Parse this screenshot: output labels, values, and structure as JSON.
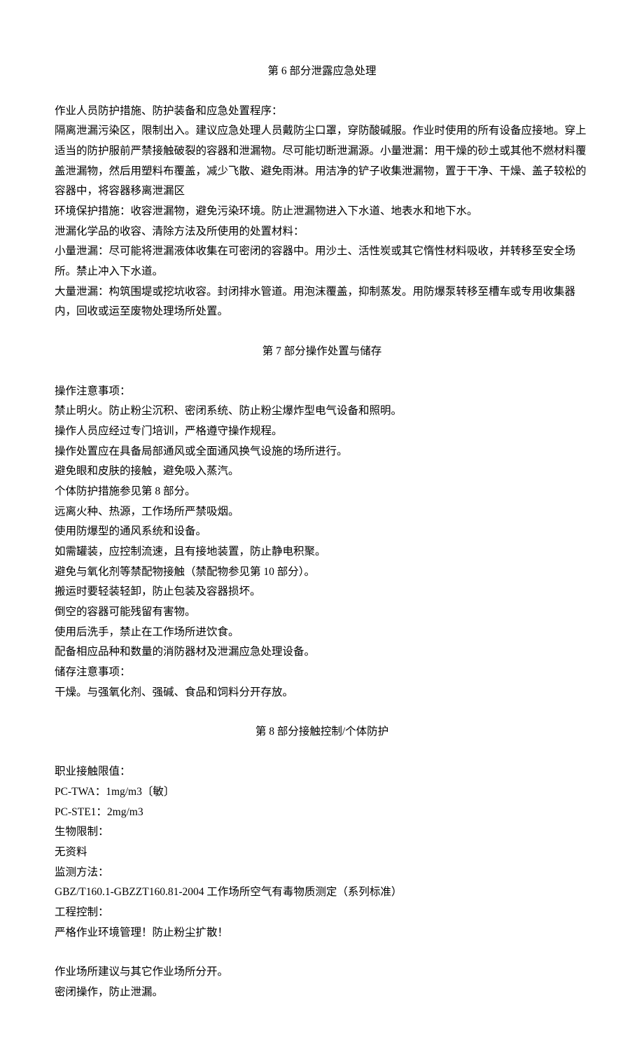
{
  "section6": {
    "title": "第 6 部分泄露应急处理",
    "p1": "作业人员防护措施、防护装备和应急处置程序：",
    "p2": "隔离泄漏污染区，限制出入。建议应急处理人员戴防尘口罩，穿防酸碱服。作业时使用的所有设备应接地。穿上适当的防护服前严禁接触破裂的容器和泄漏物。尽可能切断泄漏源。小量泄漏：用干燥的砂土或其他不燃材料覆盖泄漏物，然后用塑料布覆盖，减少飞散、避免雨淋。用洁净的铲子收集泄漏物，置于干净、干燥、盖子较松的容器中，将容器移离泄漏区",
    "p3": "环境保护措施：收容泄漏物，避免污染环境。防止泄漏物进入下水道、地表水和地下水。",
    "p4": "泄漏化学品的收容、清除方法及所使用的处置材料：",
    "p5": "小量泄漏：尽可能将泄漏液体收集在可密闭的容器中。用沙土、活性炭或其它惰性材料吸收，并转移至安全场所。禁止冲入下水道。",
    "p6": "大量泄漏：构筑围堤或挖坑收容。封闭排水管道。用泡沫覆盖，抑制蒸发。用防爆泵转移至槽车或专用收集器内，回收或运至废物处理场所处置。"
  },
  "section7": {
    "title": "第 7 部分操作处置与储存",
    "p1": "操作注意事项：",
    "p2": "禁止明火。防止粉尘沉积、密闭系统、防止粉尘爆炸型电气设备和照明。",
    "p3": "操作人员应经过专门培训，严格遵守操作规程。",
    "p4": "操作处置应在具备局部通风或全面通风换气设施的场所进行。",
    "p5": "避免眼和皮肤的接触，避免吸入蒸汽。",
    "p6": "个体防护措施参见第 8 部分。",
    "p7": "远离火种、热源，工作场所严禁吸烟。",
    "p8": "使用防爆型的通风系统和设备。",
    "p9": "如需罐装，应控制流速，且有接地装置，防止静电积聚。",
    "p10": "避免与氧化剂等禁配物接触（禁配物参见第 10 部分）。",
    "p11": "搬运时要轻装轻卸，防止包装及容器损坏。",
    "p12": "倒空的容器可能残留有害物。",
    "p13": "使用后洗手，禁止在工作场所进饮食。",
    "p14": "配备相应品种和数量的消防器材及泄漏应急处理设备。",
    "p15": "储存注意事项：",
    "p16": "干燥。与强氧化剂、强碱、食品和饲料分开存放。"
  },
  "section8": {
    "title": "第 8 部分接触控制/个体防护",
    "p1": "职业接触限值：",
    "p2": "PC-TWA：1mg/m3〔敏〕",
    "p3": "PC-STE1：2mg/m3",
    "p4": "生物限制：",
    "p5": "无资料",
    "p6": "监测方法：",
    "p7": "GBZ/T160.1-GBZZT160.81-2004 工作场所空气有毒物质测定（系列标准）",
    "p8": "工程控制：",
    "p9": "严格作业环境管理！防止粉尘扩散！",
    "p10": "作业场所建议与其它作业场所分开。",
    "p11": "密闭操作，防止泄漏。"
  }
}
